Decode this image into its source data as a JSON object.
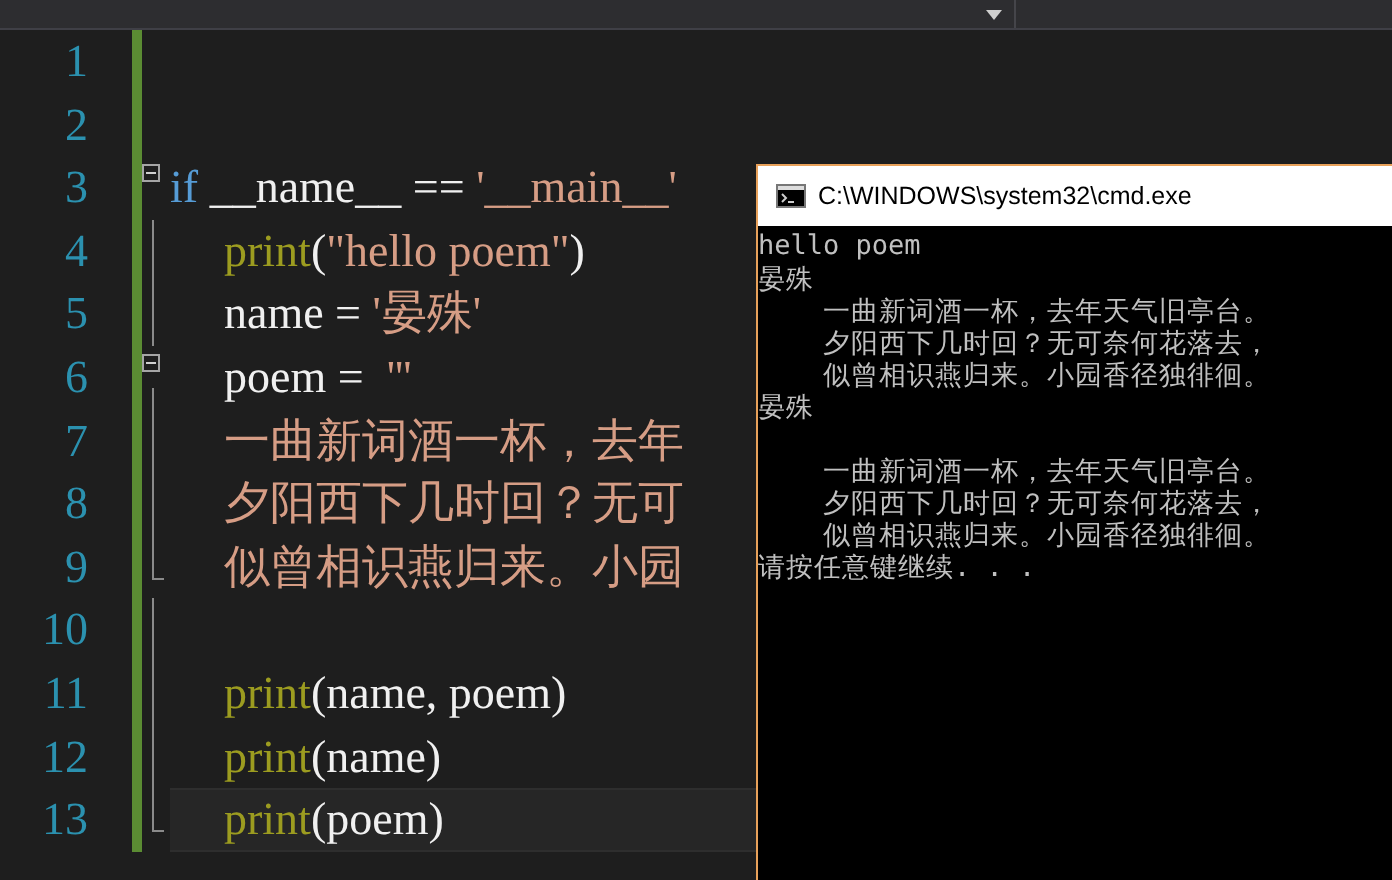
{
  "editor": {
    "lines": [
      {
        "number": "1",
        "fold_start": false,
        "fold_end": false,
        "current": false
      },
      {
        "number": "2",
        "fold_start": false,
        "fold_end": false,
        "current": false
      },
      {
        "number": "3",
        "fold_start": true,
        "fold_end": false,
        "current": false,
        "indent": false,
        "tokens": [
          {
            "kind": "keyword",
            "text": "if"
          },
          {
            "kind": "plain",
            "text": " __name__ == "
          },
          {
            "kind": "string",
            "text": "'__main__'"
          }
        ]
      },
      {
        "number": "4",
        "fold_start": false,
        "fold_end": false,
        "current": false,
        "indent": true,
        "tokens": [
          {
            "kind": "builtin",
            "text": "print"
          },
          {
            "kind": "plain",
            "text": "("
          },
          {
            "kind": "string",
            "text": "\"hello poem\""
          },
          {
            "kind": "plain",
            "text": ")"
          }
        ]
      },
      {
        "number": "5",
        "fold_start": false,
        "fold_end": false,
        "current": false,
        "indent": true,
        "tokens": [
          {
            "kind": "plain",
            "text": "name = "
          },
          {
            "kind": "string",
            "text": "'晏殊'"
          }
        ]
      },
      {
        "number": "6",
        "fold_start": true,
        "fold_end": false,
        "current": false,
        "indent": true,
        "tokens": [
          {
            "kind": "plain",
            "text": "poem =  "
          },
          {
            "kind": "string",
            "text": "'''"
          }
        ]
      },
      {
        "number": "7",
        "fold_start": false,
        "fold_end": false,
        "current": false,
        "indent": true,
        "tokens": [
          {
            "kind": "string",
            "text": "一曲新词酒一杯，去年"
          }
        ]
      },
      {
        "number": "8",
        "fold_start": false,
        "fold_end": false,
        "current": false,
        "indent": true,
        "tokens": [
          {
            "kind": "string",
            "text": "夕阳西下几时回？无可"
          }
        ]
      },
      {
        "number": "9",
        "fold_start": false,
        "fold_end": true,
        "current": false,
        "indent": true,
        "tokens": [
          {
            "kind": "string",
            "text": "似曾相识燕归来。小园"
          }
        ]
      },
      {
        "number": "10",
        "fold_start": false,
        "fold_end": false,
        "current": false
      },
      {
        "number": "11",
        "fold_start": false,
        "fold_end": false,
        "current": false,
        "indent": true,
        "tokens": [
          {
            "kind": "builtin",
            "text": "print"
          },
          {
            "kind": "plain",
            "text": "(name, poem)"
          }
        ]
      },
      {
        "number": "12",
        "fold_start": false,
        "fold_end": false,
        "current": false,
        "indent": true,
        "tokens": [
          {
            "kind": "builtin",
            "text": "print"
          },
          {
            "kind": "plain",
            "text": "(name)"
          }
        ]
      },
      {
        "number": "13",
        "fold_start": false,
        "fold_end": true,
        "current": true,
        "indent": true,
        "tokens": [
          {
            "kind": "builtin",
            "text": "print"
          },
          {
            "kind": "plain",
            "text": "(poem)"
          }
        ]
      }
    ]
  },
  "console": {
    "title": "C:\\WINDOWS\\system32\\cmd.exe",
    "output_blocks": [
      {
        "lines": [
          "hello poem",
          "晏殊",
          "    一曲新词酒一杯，去年天气旧亭台。",
          "    夕阳西下几时回？无可奈何花落去，",
          "    似曾相识燕归来。小园香径独徘徊。",
          "晏殊"
        ]
      },
      {
        "lines": [
          "    一曲新词酒一杯，去年天气旧亭台。",
          "    夕阳西下几时回？无可奈何花落去，",
          "    似曾相识燕归来。小园香径独徘徊。",
          "请按任意键继续. . ."
        ]
      }
    ]
  }
}
